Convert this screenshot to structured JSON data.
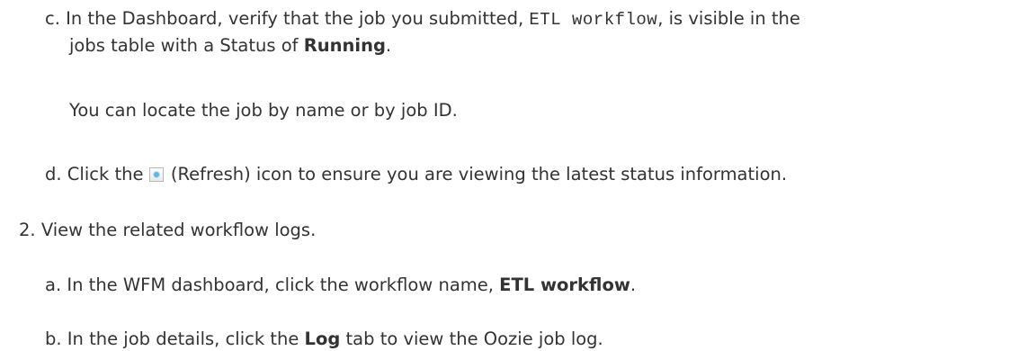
{
  "steps": {
    "c": {
      "marker": "c.",
      "line1_prefix": "In the Dashboard, verify that the job you submitted, ",
      "job_code": "ETL workflow",
      "line1_suffix": ", is visible in the",
      "line2_prefix": "jobs table with a Status of ",
      "status_value": "Running",
      "line2_suffix": ".",
      "note": "You can locate the job by name or by job ID."
    },
    "d": {
      "marker": "d.",
      "prefix": "Click the ",
      "icon": "refresh-icon",
      "suffix": " (Refresh) icon to ensure you are viewing the latest status information."
    },
    "step2": {
      "marker": "2.",
      "text": "View the related workflow logs."
    },
    "a": {
      "marker": "a.",
      "prefix": "In the WFM dashboard, click the workflow name, ",
      "workflow_name": "ETL workflow",
      "suffix": "."
    },
    "b": {
      "marker": "b.",
      "prefix": "In the job details, click the ",
      "tab_name": "Log",
      "suffix": " tab to view the Oozie job log."
    }
  }
}
